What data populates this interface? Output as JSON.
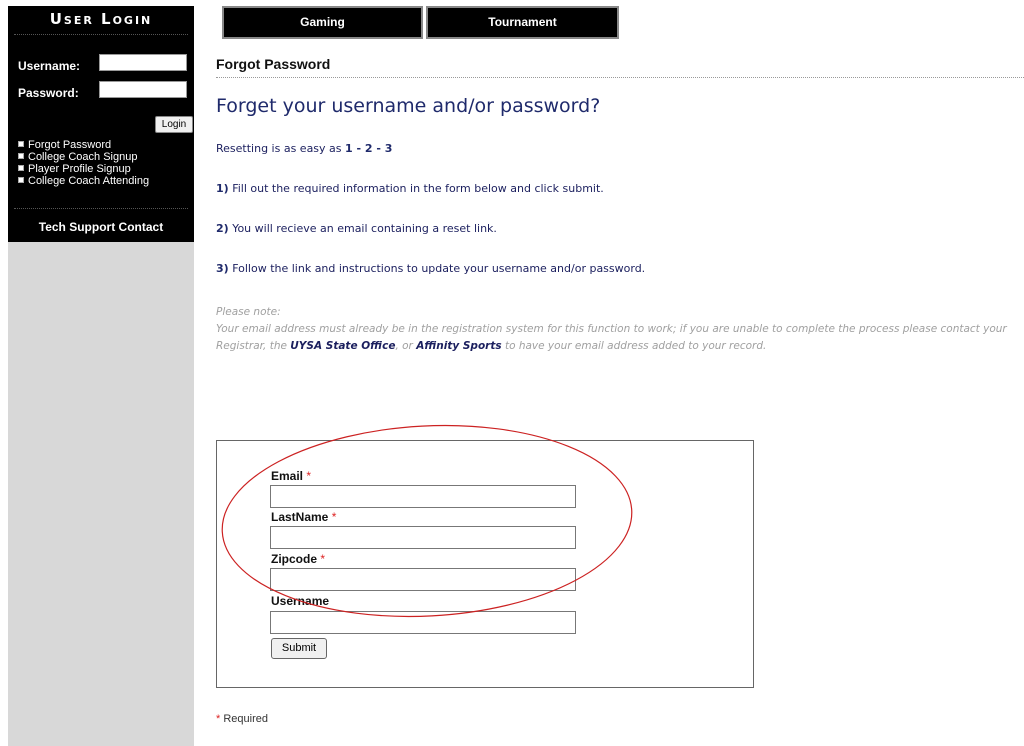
{
  "sidebar": {
    "title": "User Login",
    "username_label": "Username:",
    "username_value": "",
    "password_label": "Password:",
    "password_value": "",
    "login_label": "Login",
    "links": [
      "Forgot Password",
      "College Coach Signup",
      "Player Profile Signup",
      "College Coach Attending"
    ],
    "tech_support": "Tech Support Contact"
  },
  "tabs": [
    "Gaming",
    "Tournament"
  ],
  "main": {
    "section_title": "Forgot Password",
    "headline": "Forget your username and/or password?",
    "intro_prefix": "Resetting is as easy as",
    "intro_steps": "1 - 2 - 3",
    "steps": [
      {
        "num": "1)",
        "text": "Fill out the required information in the form below and click submit."
      },
      {
        "num": "2)",
        "text": "You will recieve an email containing a reset link."
      },
      {
        "num": "3)",
        "text": "Follow the link and instructions to update your username and/or password."
      }
    ],
    "note_heading": "Please note:",
    "note_part1": "Your email address must already be in the registration system for this function to work; if you are unable to complete the process please contact your Registrar, the",
    "note_link1": "UYSA State Office",
    "note_part2": ", or",
    "note_link2": "Affinity Sports",
    "note_part3": "to have your email address added to your record."
  },
  "form": {
    "fields": [
      {
        "label": "Email",
        "required": "*",
        "value": ""
      },
      {
        "label": "LastName",
        "required": "*",
        "value": ""
      },
      {
        "label": "Zipcode",
        "required": "*",
        "value": ""
      },
      {
        "label": "Username",
        "required": "",
        "value": ""
      }
    ],
    "submit_label": "Submit",
    "required_marker": "*",
    "required_text": "Required"
  },
  "colors": {
    "sidebar_black": "#000000",
    "sidebar_gray": "#d8d8d8",
    "headline_navy": "#1f2a6b",
    "note_gray": "#a0a0a0",
    "required_red": "#dd2222",
    "annotation_red": "#cc2222"
  }
}
